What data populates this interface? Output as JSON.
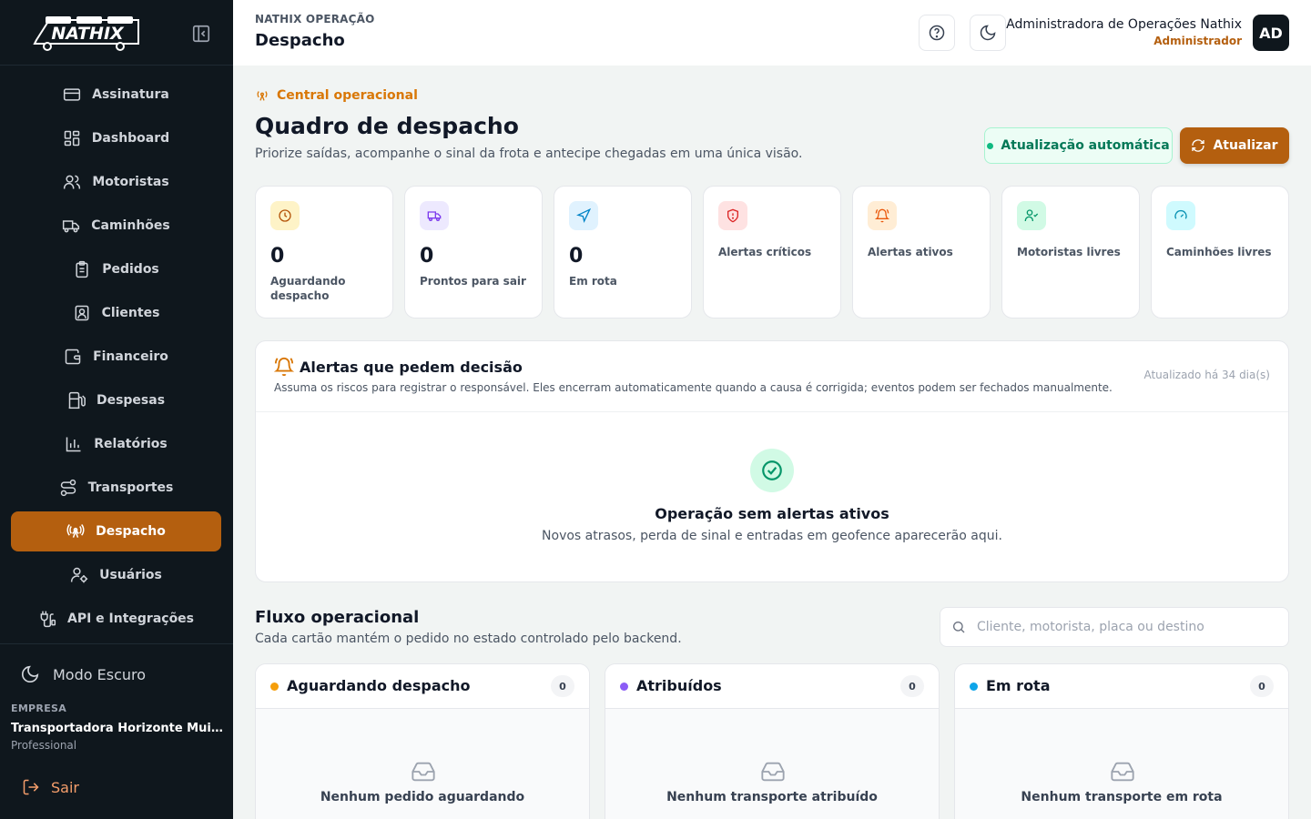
{
  "brand": {
    "logo_text": "NATHIX"
  },
  "sidebar": {
    "items": [
      {
        "label": "Assinatura",
        "icon": "credit-card-icon"
      },
      {
        "label": "Dashboard",
        "icon": "dashboard-grid-icon"
      },
      {
        "label": "Motoristas",
        "icon": "users-icon"
      },
      {
        "label": "Caminhões",
        "icon": "truck-icon"
      },
      {
        "label": "Pedidos",
        "icon": "clipboard-icon"
      },
      {
        "label": "Clientes",
        "icon": "contact-icon"
      },
      {
        "label": "Financeiro",
        "icon": "wallet-icon"
      },
      {
        "label": "Despesas",
        "icon": "fuel-icon"
      },
      {
        "label": "Relatórios",
        "icon": "bar-chart-icon"
      },
      {
        "label": "Transportes",
        "icon": "route-icon"
      },
      {
        "label": "Despacho",
        "icon": "radio-tower-icon",
        "active": true
      },
      {
        "label": "Usuários",
        "icon": "user-cog-icon"
      },
      {
        "label": "API e Integrações",
        "icon": "plug-icon"
      }
    ],
    "dark_mode_label": "Modo Escuro",
    "company_label": "EMPRESA",
    "company_name": "Transportadora Horizonte Muit...",
    "company_plan": "Professional",
    "logout_label": "Sair"
  },
  "topbar": {
    "breadcrumb": "NATHIX OPERAÇÃO",
    "page": "Despacho",
    "user_name": "Administradora de Operações Nathix",
    "user_role": "Administrador",
    "avatar_initials": "AD"
  },
  "header": {
    "eyebrow": "Central operacional",
    "title": "Quadro de despacho",
    "subtitle": "Priorize saídas, acompanhe o sinal da frota e antecipe chegadas em uma única visão.",
    "auto_update_label": "Atualização automática",
    "refresh_label": "Atualizar"
  },
  "stats": [
    {
      "value": "0",
      "label": "Aguardando despacho",
      "icon": "clock-icon",
      "bg": "#fef3c7",
      "fg": "#b45309"
    },
    {
      "value": "0",
      "label": "Prontos para sair",
      "icon": "truck-icon",
      "bg": "#ede9fe",
      "fg": "#7c3aed"
    },
    {
      "value": "0",
      "label": "Em rota",
      "icon": "navigation-icon",
      "bg": "#e0f2fe",
      "fg": "#0284c7"
    },
    {
      "value": "",
      "label": "Alertas críticos",
      "icon": "shield-alert-icon",
      "bg": "#fee2e2",
      "fg": "#dc2626"
    },
    {
      "value": "",
      "label": "Alertas ativos",
      "icon": "bell-ring-icon",
      "bg": "#ffedd5",
      "fg": "#ea580c"
    },
    {
      "value": "",
      "label": "Motoristas livres",
      "icon": "user-check-icon",
      "bg": "#d1fae5",
      "fg": "#059669"
    },
    {
      "value": "",
      "label": "Caminhões livres",
      "icon": "gauge-icon",
      "bg": "#cffafe",
      "fg": "#0891b2"
    }
  ],
  "alerts": {
    "title": "Alertas que pedem decisão",
    "description": "Assuma os riscos para registrar o responsável. Eles encerram automaticamente quando a causa é corrigida; eventos podem ser fechados manualmente.",
    "updated": "Atualizado há 34 dia(s)",
    "empty_title": "Operação sem alertas ativos",
    "empty_desc": "Novos atrasos, perda de sinal e entradas em geofence aparecerão aqui."
  },
  "flow": {
    "title": "Fluxo operacional",
    "subtitle": "Cada cartão mantém o pedido no estado controlado pelo backend.",
    "search_placeholder": "Cliente, motorista, placa ou destino",
    "columns": [
      {
        "title": "Aguardando despacho",
        "count": "0",
        "color": "#f59e0b",
        "empty": "Nenhum pedido aguardando"
      },
      {
        "title": "Atribuídos",
        "count": "0",
        "color": "#8b5cf6",
        "empty": "Nenhum transporte atribuído"
      },
      {
        "title": "Em rota",
        "count": "0",
        "color": "#0ea5e9",
        "empty": "Nenhum transporte em rota"
      }
    ]
  }
}
